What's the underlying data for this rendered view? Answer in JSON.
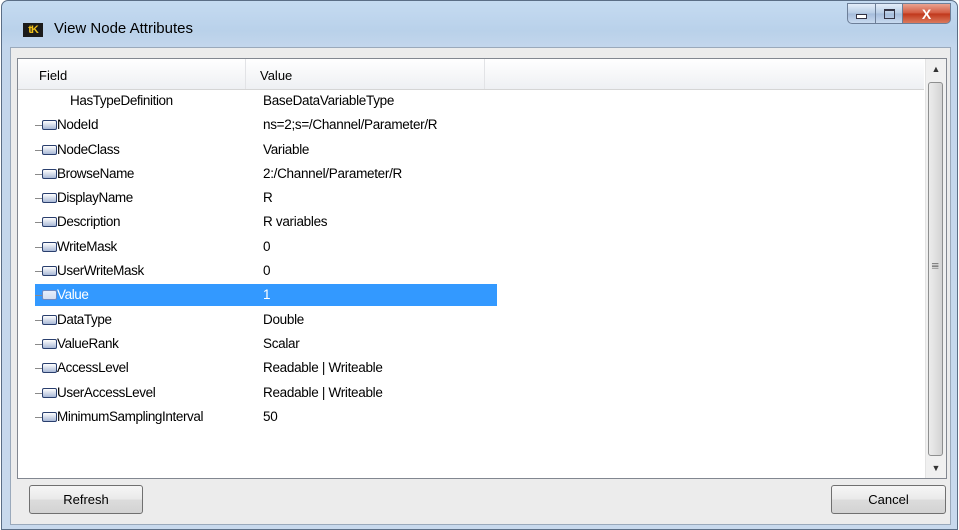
{
  "window": {
    "title": "View Node Attributes",
    "icon_text": "tK",
    "controls": {
      "minimize": "minimize",
      "maximize": "maximize",
      "close": "X"
    }
  },
  "grid": {
    "columns": {
      "field": "Field",
      "value": "Value"
    },
    "rows": [
      {
        "field": "HasTypeDefinition",
        "value": "BaseDataVariableType",
        "has_icon": false
      },
      {
        "field": "NodeId",
        "value": "ns=2;s=/Channel/Parameter/R",
        "has_icon": true
      },
      {
        "field": "NodeClass",
        "value": "Variable",
        "has_icon": true
      },
      {
        "field": "BrowseName",
        "value": "2:/Channel/Parameter/R",
        "has_icon": true
      },
      {
        "field": "DisplayName",
        "value": "R",
        "has_icon": true
      },
      {
        "field": "Description",
        "value": "R variables",
        "has_icon": true
      },
      {
        "field": "WriteMask",
        "value": "0",
        "has_icon": true
      },
      {
        "field": "UserWriteMask",
        "value": "0",
        "has_icon": true
      },
      {
        "field": "Value",
        "value": "1",
        "has_icon": true,
        "selected": true
      },
      {
        "field": "DataType",
        "value": "Double",
        "has_icon": true
      },
      {
        "field": "ValueRank",
        "value": "Scalar",
        "has_icon": true
      },
      {
        "field": "AccessLevel",
        "value": "Readable | Writeable",
        "has_icon": true
      },
      {
        "field": "UserAccessLevel",
        "value": "Readable | Writeable",
        "has_icon": true
      },
      {
        "field": "MinimumSamplingInterval",
        "value": "50",
        "has_icon": true
      }
    ]
  },
  "buttons": {
    "refresh": "Refresh",
    "cancel": "Cancel"
  },
  "colors": {
    "selection": "#3399ff",
    "title_bar": "#b9d1ea",
    "close_button": "#c0361a"
  },
  "icons": {
    "node": "node-icon",
    "scroll_up": "scroll-up-icon",
    "scroll_down": "scroll-down-icon"
  }
}
